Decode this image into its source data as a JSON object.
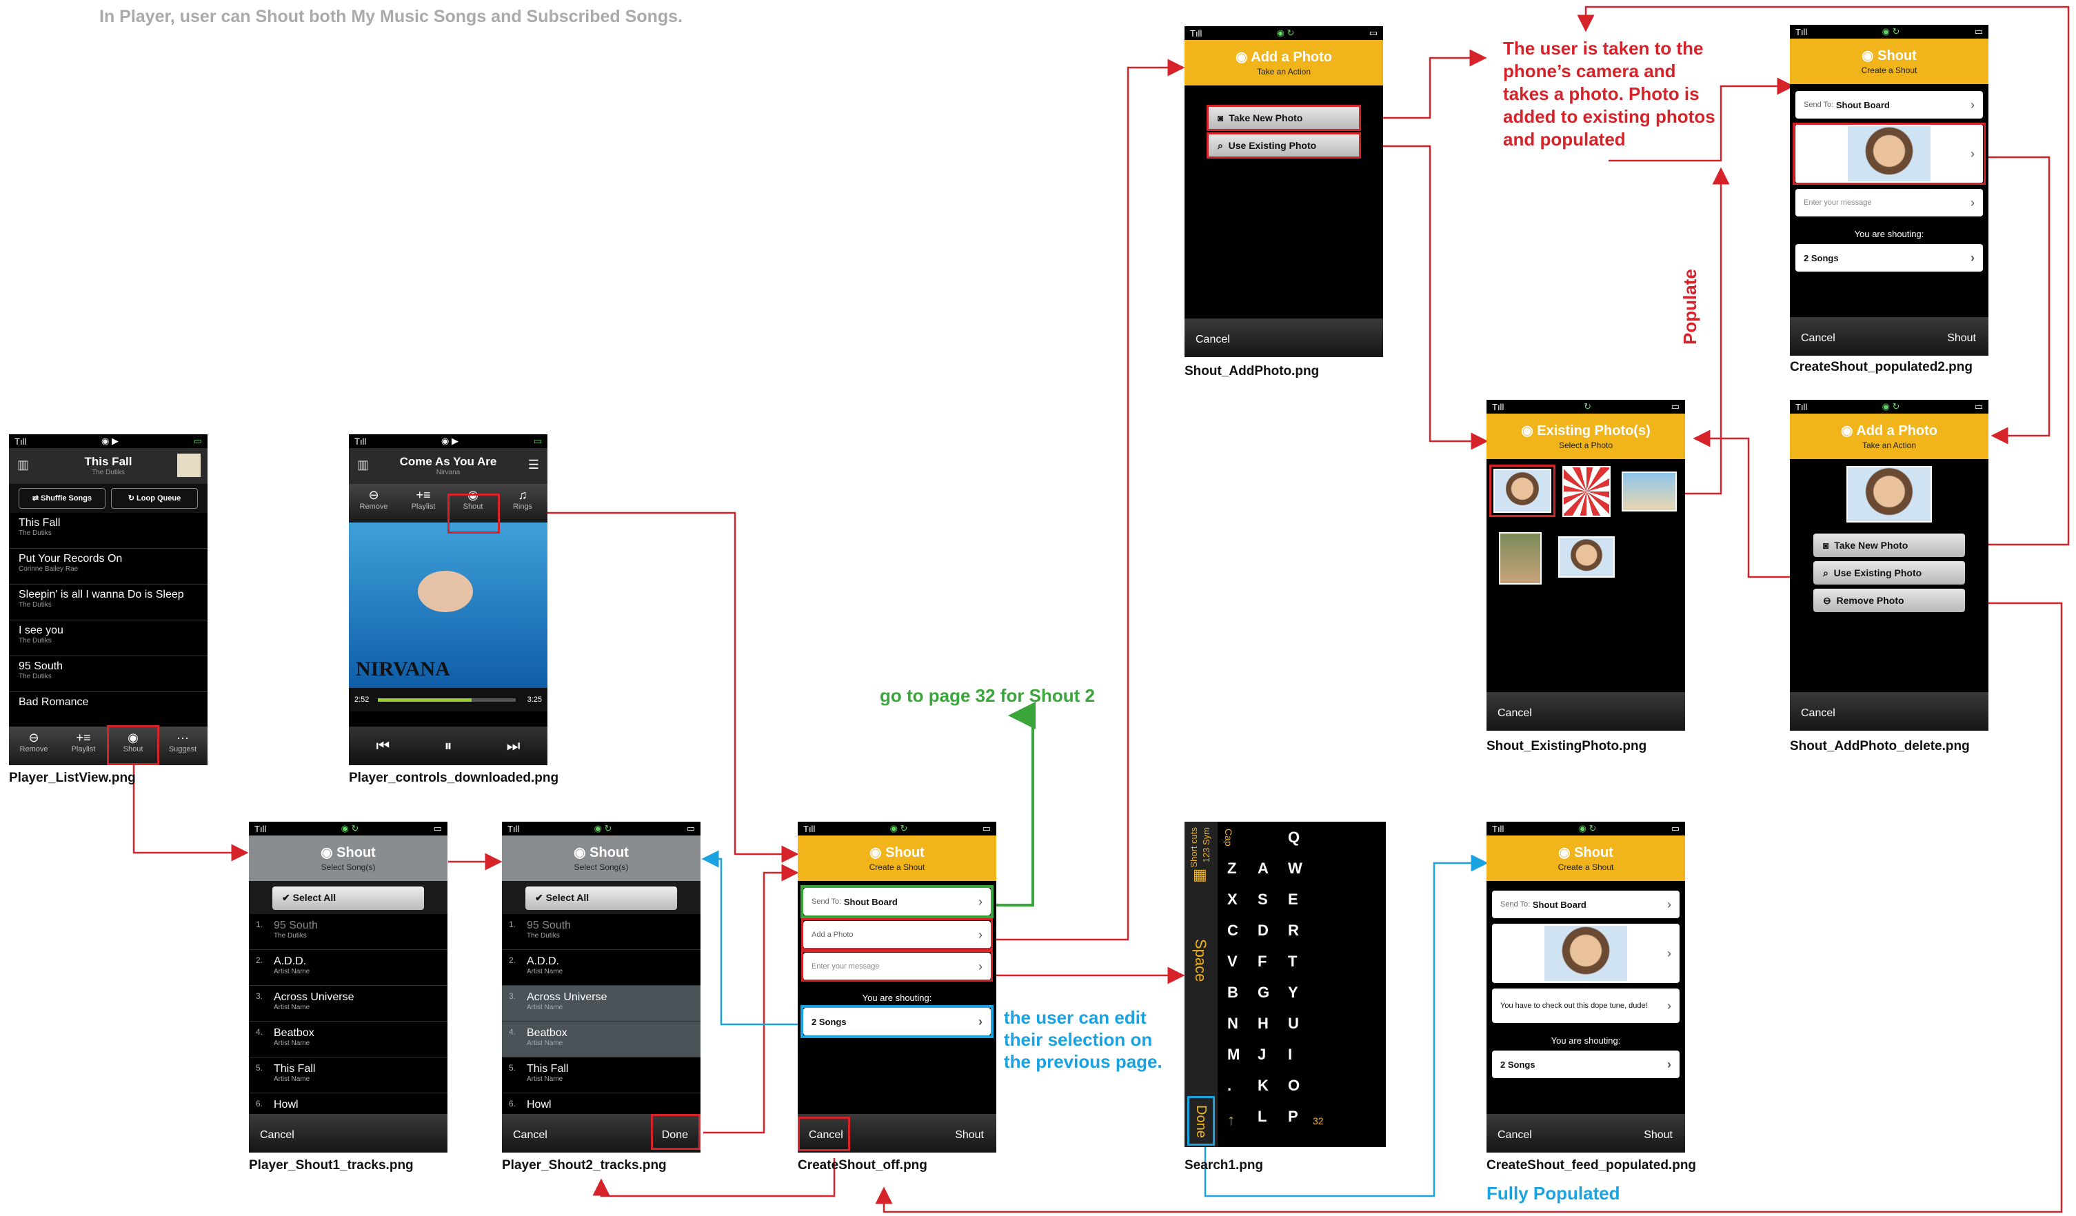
{
  "page_note": "In Player, user can Shout both My Music Songs and Subscribed Songs.",
  "captions": {
    "listview": "Player_ListView.png",
    "controls": "Player_controls_downloaded.png",
    "shout1": "Player_Shout1_tracks.png",
    "shout2": "Player_Shout2_tracks.png",
    "createoff": "CreateShout_off.png",
    "addphoto": "Shout_AddPhoto.png",
    "existing": "Shout_ExistingPhoto.png",
    "populated2": "CreateShout_populated2.png",
    "addphoto_delete": "Shout_AddPhoto_delete.png",
    "search": "Search1.png",
    "feed": "CreateShout_feed_populated.png"
  },
  "annotations": {
    "green": "go to page 32 for Shout 2",
    "blue": "the user can edit their selection on the previous page.",
    "red": "The user is taken to the phone’s camera and takes a photo. Photo is added to existing photos and populated",
    "populate": "Populate",
    "fully": "Fully Populated"
  },
  "listview": {
    "title": "This Fall",
    "artist": "The Dutiks",
    "shuffle": "Shuffle Songs",
    "loop": "Loop Queue",
    "rows": [
      {
        "t": "This Fall",
        "a": "The Dutiks"
      },
      {
        "t": "Put Your Records On",
        "a": "Corinne Bailey Rae"
      },
      {
        "t": "Sleepin' is all I wanna Do is Sleep",
        "a": "The Dutiks"
      },
      {
        "t": "I see you",
        "a": "The Dutiks"
      },
      {
        "t": "95 South",
        "a": "The Dutiks"
      },
      {
        "t": "Bad Romance",
        "a": ""
      }
    ],
    "tabs": [
      "Remove",
      "Playlist",
      "Shout",
      "Suggest"
    ]
  },
  "controls": {
    "title": "Come As You Are",
    "artist": "Nirvana",
    "tabs": [
      "Remove",
      "Playlist",
      "Shout",
      "Rings"
    ],
    "time_start": "2:52",
    "time_end": "3:25",
    "progress": 0.68
  },
  "shout_tracks": {
    "title": "Shout",
    "subtitle": "Select Song(s)",
    "select_all": "Select All",
    "tracks": [
      {
        "n": "1.",
        "t": "95 South",
        "a": "The Dutiks"
      },
      {
        "n": "2.",
        "t": "A.D.D.",
        "a": "Artist Name"
      },
      {
        "n": "3.",
        "t": "Across Universe",
        "a": "Artist Name"
      },
      {
        "n": "4.",
        "t": "Beatbox",
        "a": "Artist Name"
      },
      {
        "n": "5.",
        "t": "This Fall",
        "a": "Artist Name"
      },
      {
        "n": "6.",
        "t": "Howl",
        "a": ""
      }
    ],
    "cancel": "Cancel",
    "done": "Done"
  },
  "create": {
    "title": "Shout",
    "subtitle": "Create a Shout",
    "send_to": "Send To:",
    "board": "Shout Board",
    "add_photo": "Add a Photo",
    "message_ph": "Enter your message",
    "shouting": "You are shouting:",
    "songs": "2 Songs",
    "cancel": "Cancel",
    "shout": "Shout",
    "message": "You have to check out this dope tune, dude!"
  },
  "addphoto": {
    "title": "Add a Photo",
    "subtitle": "Take an Action",
    "take": "Take New Photo",
    "use": "Use Existing Photo",
    "remove": "Remove Photo",
    "cancel": "Cancel"
  },
  "existing": {
    "title": "Existing Photo(s)",
    "subtitle": "Select a Photo",
    "cancel": "Cancel"
  },
  "keyboard": {
    "rows": [
      [
        "Q",
        "W",
        "E",
        "R",
        "T",
        "Y",
        "U",
        "I",
        "O",
        "P"
      ],
      [
        "A",
        "S",
        "D",
        "F",
        "G",
        "H",
        "J",
        "K",
        "L"
      ],
      [
        "Z",
        "X",
        "C",
        "V",
        "B",
        "N",
        "M",
        "."
      ]
    ],
    "side": [
      "Short cuts",
      "123 Sym",
      "Cap"
    ],
    "space": "Space",
    "done": "Done",
    "count": "32"
  }
}
